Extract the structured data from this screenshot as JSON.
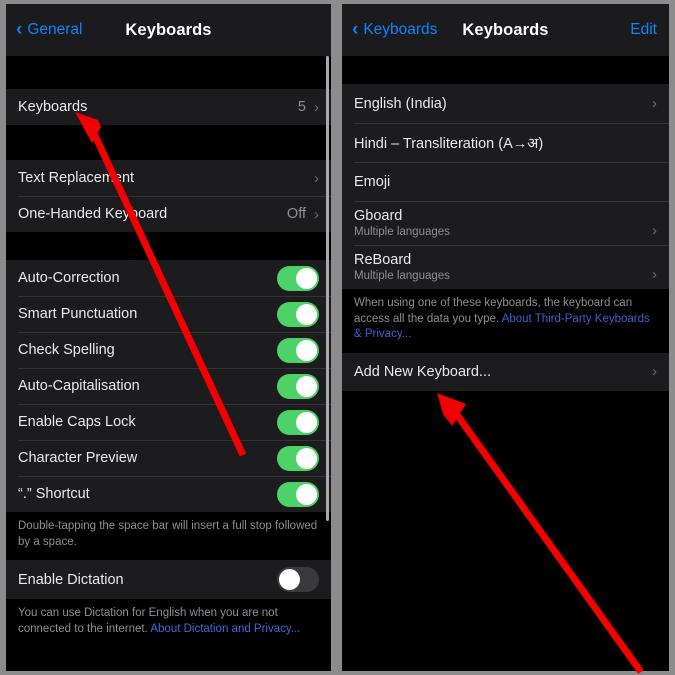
{
  "left_panel": {
    "navbar": {
      "back_label": "General",
      "title": "Keyboards",
      "back_icon": "chevron-left-icon"
    },
    "section_keyboards": {
      "rows": [
        {
          "label": "Keyboards",
          "value": "5",
          "chevron": "chevron-right-icon"
        }
      ]
    },
    "section_text": {
      "rows": [
        {
          "label": "Text Replacement",
          "value": "",
          "chevron": "chevron-right-icon"
        },
        {
          "label": "One-Handed Keyboard",
          "value": "Off",
          "chevron": "chevron-right-icon"
        }
      ]
    },
    "section_toggles": {
      "rows": [
        {
          "label": "Auto-Correction",
          "state": "on"
        },
        {
          "label": "Smart Punctuation",
          "state": "on"
        },
        {
          "label": "Check Spelling",
          "state": "on"
        },
        {
          "label": "Auto-Capitalisation",
          "state": "on"
        },
        {
          "label": "Enable Caps Lock",
          "state": "on"
        },
        {
          "label": "Character Preview",
          "state": "on"
        },
        {
          "label": "“.” Shortcut",
          "state": "on"
        }
      ],
      "footer": "Double-tapping the space bar will insert a full stop followed by a space."
    },
    "section_dictation": {
      "rows": [
        {
          "label": "Enable Dictation",
          "state": "off"
        }
      ],
      "footer_text": "You can use Dictation for English when you are not connected to the internet. ",
      "footer_link": "About Dictation and Privacy..."
    }
  },
  "right_panel": {
    "navbar": {
      "back_label": "Keyboards",
      "title": "Keyboards",
      "edit_label": "Edit",
      "back_icon": "chevron-left-icon"
    },
    "keyboard_list": [
      {
        "label": "English (India)",
        "sub": "",
        "chevron": "chevron-right-icon"
      },
      {
        "label": "Hindi – Transliteration (A→अ)",
        "sub": "",
        "chevron": ""
      },
      {
        "label": "Emoji",
        "sub": "",
        "chevron": ""
      },
      {
        "label": "Gboard",
        "sub": "Multiple languages",
        "chevron": "chevron-right-icon"
      },
      {
        "label": "ReBoard",
        "sub": "Multiple languages",
        "chevron": "chevron-right-icon"
      }
    ],
    "privacy_footer_text": "When using one of these keyboards, the keyboard can access all the data you type. ",
    "privacy_footer_link": "About Third-Party Keyboards & Privacy...",
    "add_row": {
      "label": "Add New Keyboard...",
      "chevron": "chevron-right-icon"
    }
  },
  "annotations": {
    "arrow_color": "#f50000",
    "left_arrow": "red-arrow-pointing-to-keyboards-row",
    "right_arrow": "red-arrow-pointing-to-add-new-keyboard-row"
  },
  "colors": {
    "accent_blue": "#0a84ff",
    "toggle_on_green": "#4cd267",
    "row_background": "#1c1c1e",
    "page_background": "#000000"
  }
}
